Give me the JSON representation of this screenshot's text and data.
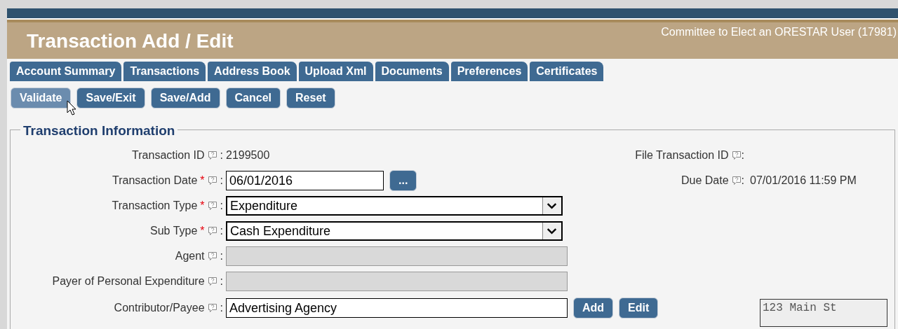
{
  "header": {
    "title": "Transaction Add / Edit",
    "committee": "Committee to Elect an ORESTAR User (17981)"
  },
  "tabs": [
    "Account Summary",
    "Transactions",
    "Address Book",
    "Upload Xml",
    "Documents",
    "Preferences",
    "Certificates"
  ],
  "actions": [
    {
      "label": "Validate",
      "hovered": true
    },
    {
      "label": "Save/Exit",
      "hovered": false
    },
    {
      "label": "Save/Add",
      "hovered": false
    },
    {
      "label": "Cancel",
      "hovered": false
    },
    {
      "label": "Reset",
      "hovered": false
    }
  ],
  "section": {
    "legend": "Transaction Information",
    "required_mark": "*",
    "colon": ":",
    "fields": [
      {
        "kind": "text",
        "label": "Transaction ID",
        "required": false,
        "value": "2199500"
      },
      {
        "kind": "date",
        "label": "Transaction Date",
        "required": true,
        "value": "06/01/2016",
        "button": "..."
      },
      {
        "kind": "select",
        "label": "Transaction Type",
        "required": true,
        "value": "Expenditure"
      },
      {
        "kind": "select",
        "label": "Sub Type",
        "required": true,
        "value": "Cash Expenditure"
      },
      {
        "kind": "disabled",
        "label": "Agent",
        "required": false
      },
      {
        "kind": "disabled",
        "label": "Payer of Personal Expenditure",
        "required": false
      },
      {
        "kind": "lookup",
        "label": "Contributor/Payee",
        "required": false,
        "value": "Advertising Agency",
        "buttons": [
          "Add",
          "Edit"
        ]
      }
    ],
    "right_fields": [
      {
        "label": "File Transaction ID"
      },
      {
        "label": "Due Date",
        "value": "07/01/2016 11:59 PM"
      }
    ],
    "address": "123 Main St"
  }
}
